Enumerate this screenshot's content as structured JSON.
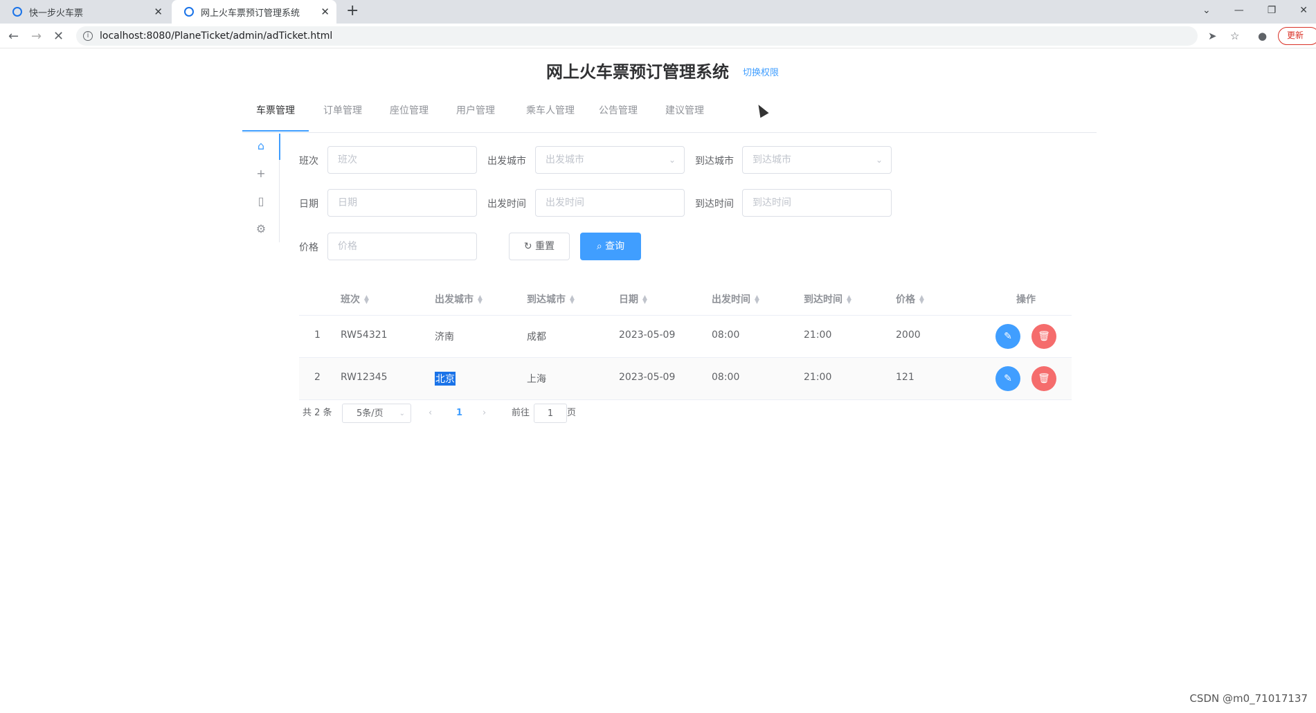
{
  "browser": {
    "tabs": [
      {
        "title": "快一步火车票",
        "active": false
      },
      {
        "title": "网上火车票预订管理系统",
        "active": true
      }
    ],
    "url": "localhost:8080/PlaneTicket/admin/adTicket.html",
    "update_label": "更新"
  },
  "header": {
    "title": "网上火车票预订管理系统",
    "switch_link": "切换权限"
  },
  "topnav": {
    "items": [
      "车票管理",
      "订单管理",
      "座位管理",
      "用户管理",
      "乘车人管理",
      "公告管理",
      "建议管理"
    ],
    "active_index": 0
  },
  "sidebar": {
    "icons": [
      "home-icon",
      "plus-icon",
      "clipboard-icon",
      "settings-icon"
    ]
  },
  "form": {
    "train_no": {
      "label": "班次",
      "placeholder": "班次"
    },
    "from_city": {
      "label": "出发城市",
      "placeholder": "出发城市"
    },
    "to_city": {
      "label": "到达城市",
      "placeholder": "到达城市"
    },
    "date": {
      "label": "日期",
      "placeholder": "日期"
    },
    "depart_time": {
      "label": "出发时间",
      "placeholder": "出发时间"
    },
    "arrive_time": {
      "label": "到达时间",
      "placeholder": "到达时间"
    },
    "price": {
      "label": "价格",
      "placeholder": "价格"
    },
    "reset_label": "重置",
    "query_label": "查询"
  },
  "table": {
    "columns": [
      "班次",
      "出发城市",
      "到达城市",
      "日期",
      "出发时间",
      "到达时间",
      "价格",
      "操作"
    ],
    "rows": [
      {
        "index": "1",
        "train_no": "RW54321",
        "from": "济南",
        "to": "成都",
        "date": "2023-05-09",
        "depart": "08:00",
        "arrive": "21:00",
        "price": "2000"
      },
      {
        "index": "2",
        "train_no": "RW12345",
        "from": "北京",
        "to": "上海",
        "date": "2023-05-09",
        "depart": "08:00",
        "arrive": "21:00",
        "price": "121"
      }
    ]
  },
  "pagination": {
    "total": "共 2 条",
    "page_size": "5条/页",
    "current_page": "1",
    "goto_label": "前往",
    "goto_value": "1",
    "page_suffix": "页"
  },
  "watermark": "CSDN @m0_71017137",
  "colors": {
    "primary": "#409eff",
    "danger": "#f56c6c"
  }
}
